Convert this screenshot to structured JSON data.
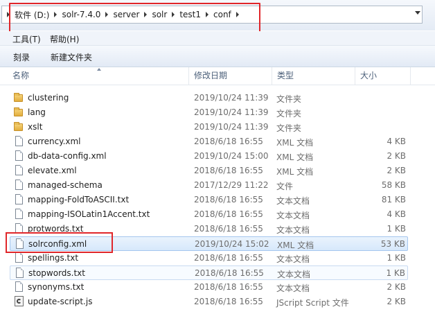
{
  "address": {
    "crumbs": [
      "软件 (D:)",
      "solr-7.4.0",
      "server",
      "solr",
      "test1",
      "conf"
    ]
  },
  "menu": {
    "tools": "工具(T)",
    "help": "帮助(H)"
  },
  "toolbar": {
    "burn": "刻录",
    "new_folder": "新建文件夹"
  },
  "columns": {
    "name": "名称",
    "date": "修改日期",
    "type": "类型",
    "size": "大小"
  },
  "files": [
    {
      "name": "clustering",
      "date": "2019/10/24 11:39",
      "type": "文件夹",
      "size": "",
      "icon": "folder-icon"
    },
    {
      "name": "lang",
      "date": "2019/10/24 11:39",
      "type": "文件夹",
      "size": "",
      "icon": "folder-icon"
    },
    {
      "name": "xslt",
      "date": "2019/10/24 11:39",
      "type": "文件夹",
      "size": "",
      "icon": "folder-icon"
    },
    {
      "name": "currency.xml",
      "date": "2018/6/18 16:55",
      "type": "XML 文档",
      "size": "4 KB",
      "icon": "file-icon"
    },
    {
      "name": "db-data-config.xml",
      "date": "2019/10/24 15:00",
      "type": "XML 文档",
      "size": "2 KB",
      "icon": "file-icon"
    },
    {
      "name": "elevate.xml",
      "date": "2018/6/18 16:55",
      "type": "XML 文档",
      "size": "2 KB",
      "icon": "file-icon"
    },
    {
      "name": "managed-schema",
      "date": "2017/12/29 11:22",
      "type": "文件",
      "size": "58 KB",
      "icon": "file-icon"
    },
    {
      "name": "mapping-FoldToASCII.txt",
      "date": "2018/6/18 16:55",
      "type": "文本文档",
      "size": "81 KB",
      "icon": "file-icon"
    },
    {
      "name": "mapping-ISOLatin1Accent.txt",
      "date": "2018/6/18 16:55",
      "type": "文本文档",
      "size": "4 KB",
      "icon": "file-icon"
    },
    {
      "name": "protwords.txt",
      "date": "2018/6/18 16:55",
      "type": "文本文档",
      "size": "1 KB",
      "icon": "file-icon"
    },
    {
      "name": "solrconfig.xml",
      "date": "2019/10/24 15:02",
      "type": "XML 文档",
      "size": "53 KB",
      "icon": "file-icon"
    },
    {
      "name": "spellings.txt",
      "date": "2018/6/18 16:55",
      "type": "文本文档",
      "size": "1 KB",
      "icon": "file-icon"
    },
    {
      "name": "stopwords.txt",
      "date": "2018/6/18 16:55",
      "type": "文本文档",
      "size": "1 KB",
      "icon": "file-icon"
    },
    {
      "name": "synonyms.txt",
      "date": "2018/6/18 16:55",
      "type": "文本文档",
      "size": "2 KB",
      "icon": "file-icon"
    },
    {
      "name": "update-script.js",
      "date": "2018/6/18 16:55",
      "type": "JScript Script 文件",
      "size": "2 KB",
      "icon": "script-icon"
    }
  ],
  "selected_file": "solrconfig.xml",
  "colors": {
    "highlight": "#e0262a",
    "selection": "#d7e8fb"
  }
}
